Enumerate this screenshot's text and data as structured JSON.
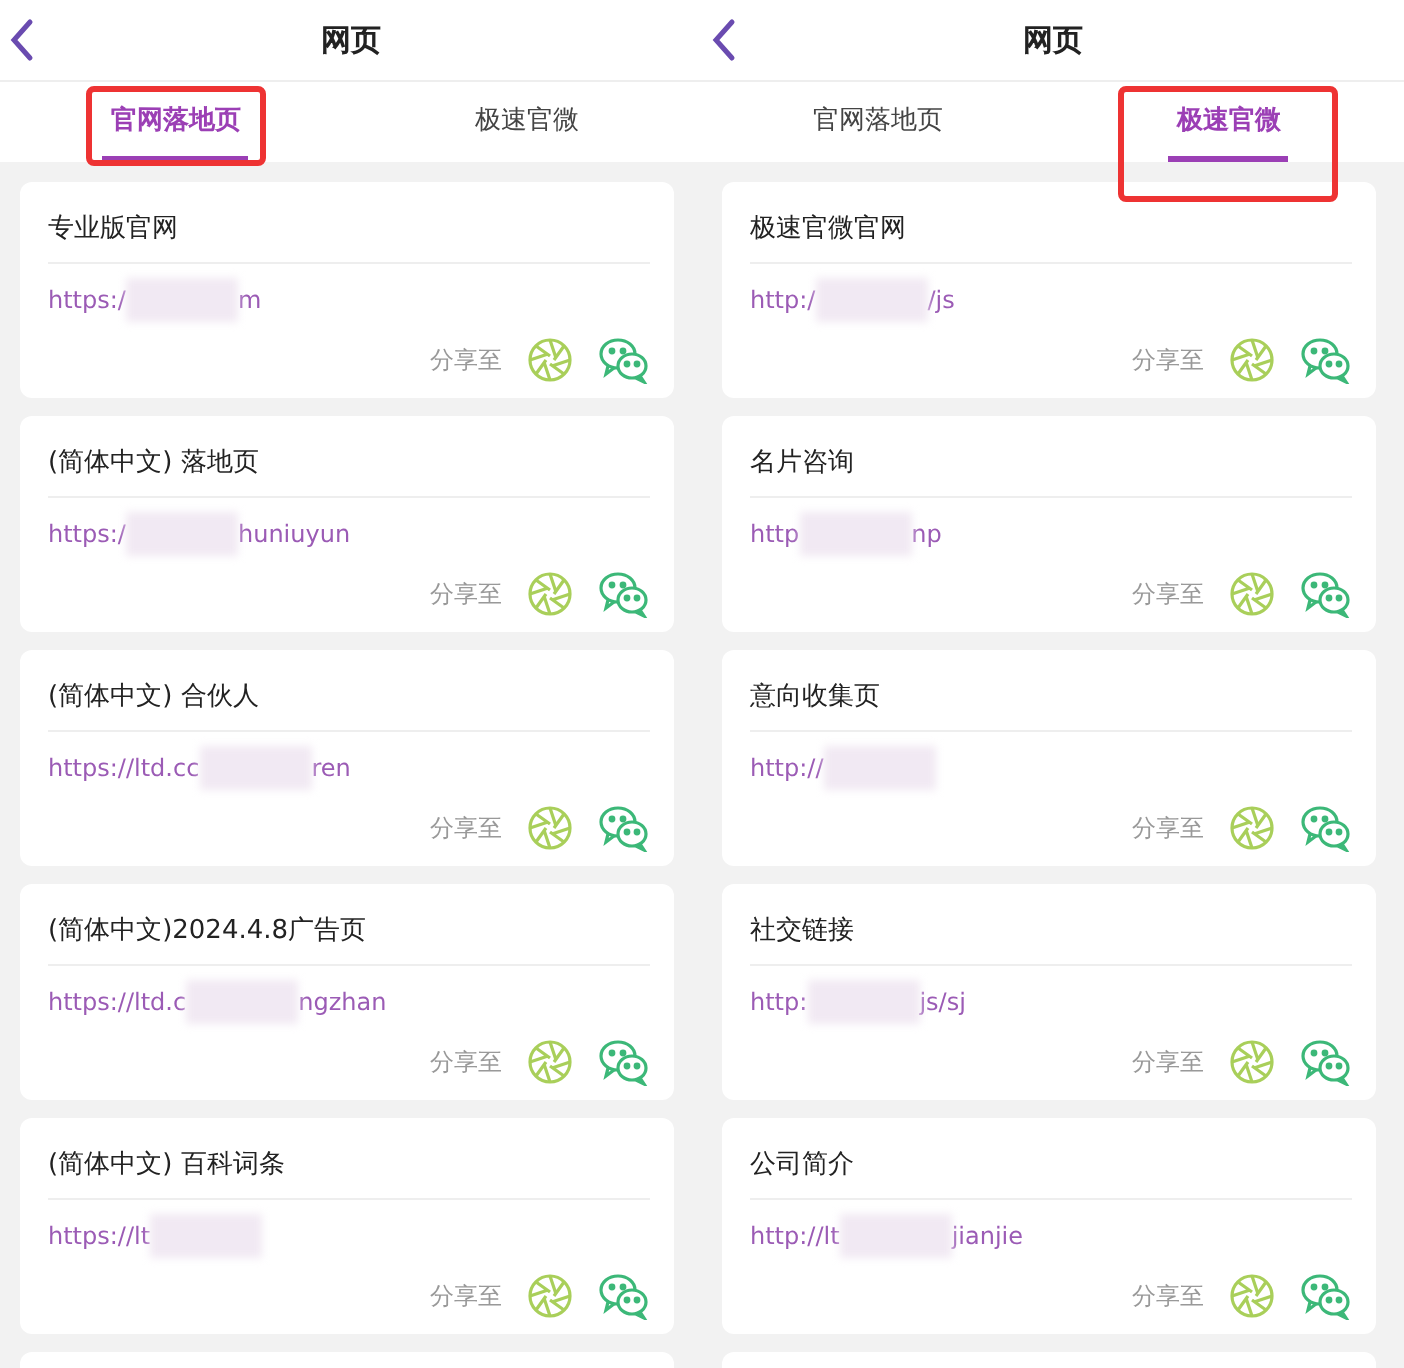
{
  "panels": [
    {
      "title": "网页",
      "tabs": [
        {
          "label": "官网落地页",
          "selected": true,
          "highlighted": true
        },
        {
          "label": "极速官微",
          "selected": false,
          "highlighted": false
        }
      ],
      "cards": [
        {
          "title": "专业版官网",
          "url_start": "https:/",
          "url_end": "m",
          "share_label": "分享至"
        },
        {
          "title": "(简体中文) 落地页",
          "url_start": "https:/",
          "url_end": "huniuyun",
          "share_label": "分享至"
        },
        {
          "title": "(简体中文) 合伙人",
          "url_start": "https://ltd.cc",
          "url_end": "ren",
          "share_label": "分享至"
        },
        {
          "title": "(简体中文)2024.4.8广告页",
          "url_start": "https://ltd.c",
          "url_end": "ngzhan",
          "share_label": "分享至"
        },
        {
          "title": "(简体中文) 百科词条",
          "url_start": "https://lt",
          "share_label": "分享至"
        }
      ]
    },
    {
      "title": "网页",
      "tabs": [
        {
          "label": "官网落地页",
          "selected": false,
          "highlighted": false
        },
        {
          "label": "极速官微",
          "selected": true,
          "highlighted": true
        }
      ],
      "cards": [
        {
          "title": "极速官微官网",
          "url_start": "http:/",
          "url_end": "/js",
          "share_label": "分享至"
        },
        {
          "title": "名片咨询",
          "url_start": "http",
          "url_end": "np",
          "share_label": "分享至"
        },
        {
          "title": "意向收集页",
          "url_start": "http://",
          "share_label": "分享至"
        },
        {
          "title": "社交链接",
          "url_start": "http:",
          "url_end": "js/sj",
          "share_label": "分享至"
        },
        {
          "title": "公司简介",
          "url_start": "http://lt",
          "url_end": "jianjie",
          "share_label": "分享至"
        }
      ]
    }
  ]
}
